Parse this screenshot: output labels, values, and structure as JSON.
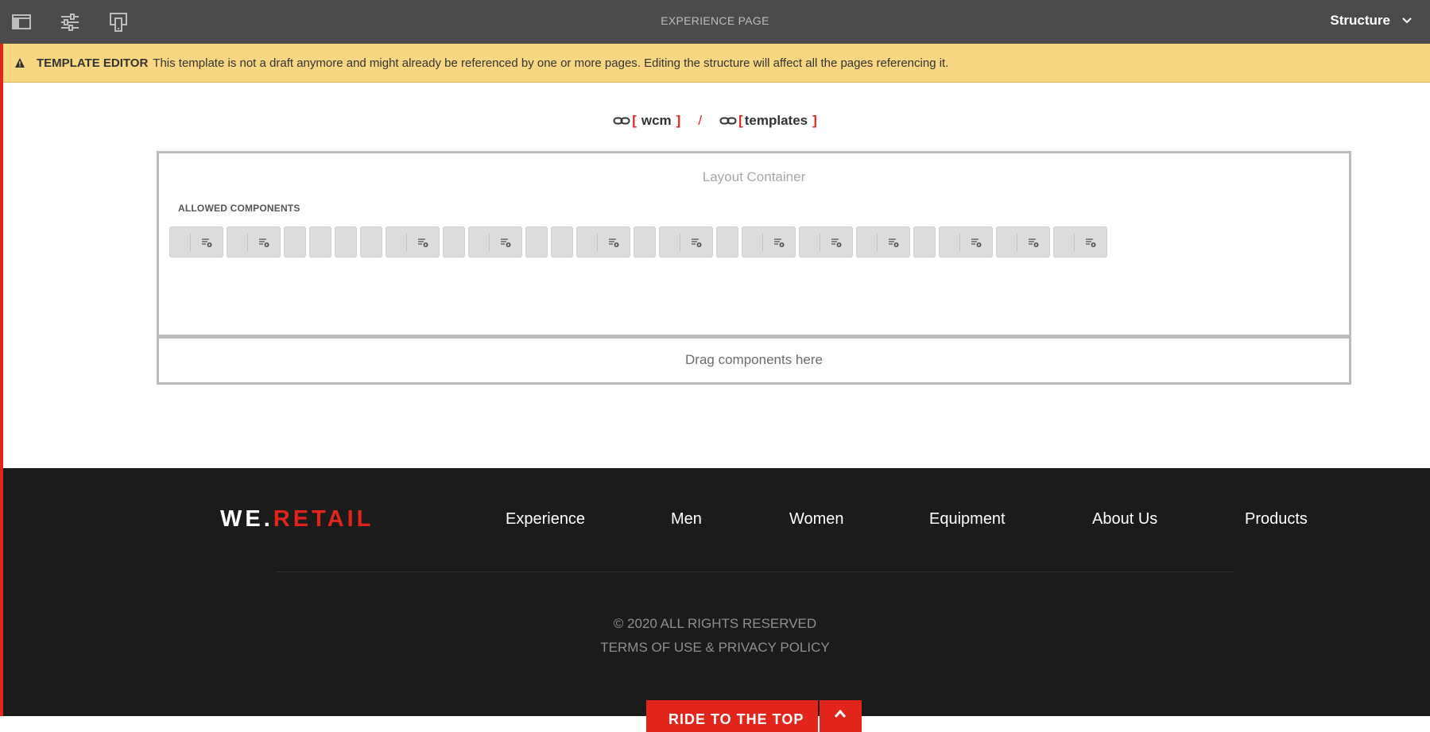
{
  "toolbar": {
    "title": "EXPERIENCE PAGE",
    "mode": "Structure",
    "icons": [
      "side-panel-icon",
      "page-properties-icon",
      "emulator-icon"
    ]
  },
  "alert": {
    "label": "TEMPLATE EDITOR",
    "message": "This template is not a draft anymore and might already be referenced by one or more pages. Editing the structure will affect all the pages referencing it."
  },
  "breadcrumb": {
    "items": [
      {
        "label": "wcm"
      },
      {
        "label": "templates"
      }
    ],
    "separator": "/",
    "open_bracket": "[",
    "close_bracket": "]"
  },
  "layout_container": {
    "title": "Layout Container",
    "allowed_label": "ALLOWED COMPONENTS",
    "dropzone": "Drag components here"
  },
  "footer": {
    "logo_left": "WE",
    "logo_dot": ".",
    "logo_right": "RETAIL",
    "nav": [
      "Experience",
      "Men",
      "Women",
      "Equipment",
      "About Us",
      "Products"
    ],
    "copyright": "© 2020 ALL RIGHTS RESERVED",
    "terms": "TERMS OF USE & PRIVACY POLICY",
    "ride": "RIDE TO THE TOP"
  },
  "colors": {
    "toolbar": "#4b4b4b",
    "alert": "#f9d681",
    "brand_red": "#e1251b",
    "footer": "#1b1b1b"
  }
}
